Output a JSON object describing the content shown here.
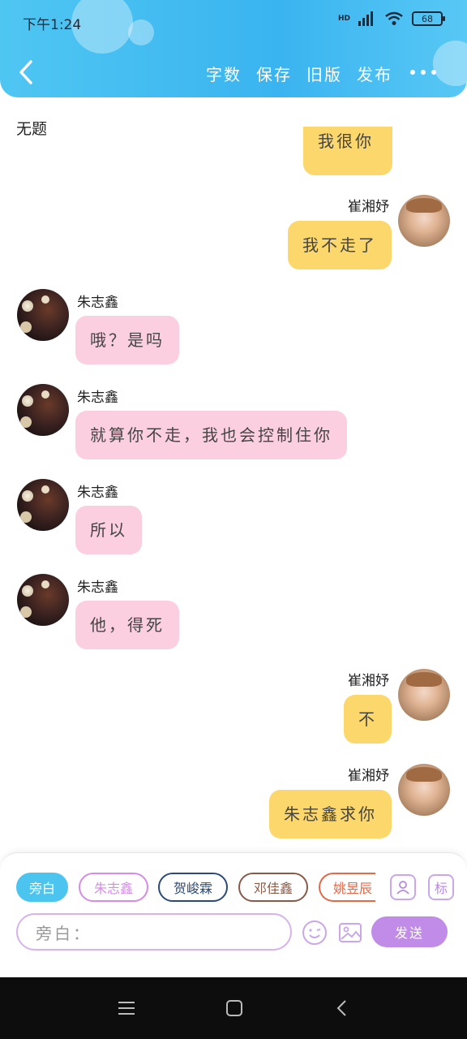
{
  "status": {
    "time": "下午1:24",
    "battery": "68",
    "signal": "HD"
  },
  "header": {
    "menu": [
      "字数",
      "保存",
      "旧版",
      "发布"
    ]
  },
  "chat": {
    "title": "无题",
    "partial_text": "我很你",
    "messages": [
      {
        "side": "right",
        "name": "崔湘妤",
        "text": "我不走了",
        "color": "yellow",
        "avatar": "girl"
      },
      {
        "side": "left",
        "name": "朱志鑫",
        "text": "哦？是吗",
        "color": "pink",
        "avatar": "boy"
      },
      {
        "side": "left",
        "name": "朱志鑫",
        "text": "就算你不走，我也会控制住你",
        "color": "pink",
        "avatar": "boy"
      },
      {
        "side": "left",
        "name": "朱志鑫",
        "text": "所以",
        "color": "pink",
        "avatar": "boy"
      },
      {
        "side": "left",
        "name": "朱志鑫",
        "text": "他，得死",
        "color": "pink",
        "avatar": "boy"
      },
      {
        "side": "right",
        "name": "崔湘妤",
        "text": "不",
        "color": "yellow",
        "avatar": "girl"
      },
      {
        "side": "right",
        "name": "崔湘妤",
        "text": "朱志鑫求你",
        "color": "yellow",
        "avatar": "girl"
      }
    ]
  },
  "panel": {
    "chips": [
      {
        "label": "旁白",
        "color": "#4cc4f0",
        "filled": true
      },
      {
        "label": "朱志鑫",
        "color": "#d58be8",
        "filled": false
      },
      {
        "label": "贺峻霖",
        "color": "#2b4a7a",
        "filled": false
      },
      {
        "label": "邓佳鑫",
        "color": "#8a5a48",
        "filled": false
      },
      {
        "label": "姚昱辰",
        "color": "#e06a4a",
        "filled": false
      }
    ],
    "label_button": "标",
    "input_placeholder": "旁白：",
    "send_label": "发送"
  },
  "colors": {
    "header": "#3ab4f0",
    "pink_bubble": "#fbcfe0",
    "yellow_bubble": "#fbd76c",
    "accent": "#c18ce8"
  }
}
